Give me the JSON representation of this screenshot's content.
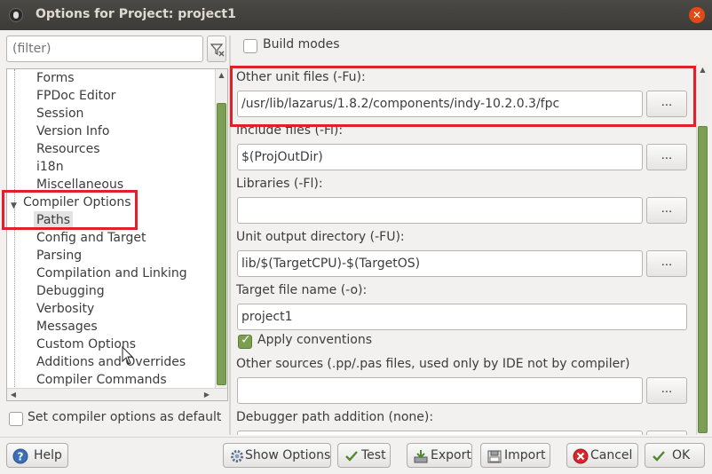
{
  "window": {
    "title": "Options for Project: project1",
    "close_glyph": "✕"
  },
  "filter": {
    "placeholder": "(filter)"
  },
  "tree": {
    "items": [
      {
        "label": "Forms"
      },
      {
        "label": "FPDoc Editor"
      },
      {
        "label": "Session"
      },
      {
        "label": "Version Info"
      },
      {
        "label": "Resources"
      },
      {
        "label": "i18n"
      },
      {
        "label": "Miscellaneous"
      },
      {
        "label": "Compiler Options"
      },
      {
        "label": "Paths",
        "selected": true
      },
      {
        "label": "Config and Target"
      },
      {
        "label": "Parsing"
      },
      {
        "label": "Compilation and Linking"
      },
      {
        "label": "Debugging"
      },
      {
        "label": "Verbosity"
      },
      {
        "label": "Messages"
      },
      {
        "label": "Custom Options"
      },
      {
        "label": "Additions and Overrides"
      },
      {
        "label": "Compiler Commands"
      }
    ]
  },
  "left_bottom": {
    "set_default_label": "Set compiler options as default",
    "set_default_checked": false
  },
  "build_modes": {
    "label": "Build modes",
    "checked": false
  },
  "fields": {
    "other_unit_files": {
      "label": "Other unit files (-Fu):",
      "value": "/usr/lib/lazarus/1.8.2/components/indy-10.2.0.3/fpc"
    },
    "include_files": {
      "label": "Include files (-Fi):",
      "value": "$(ProjOutDir)"
    },
    "libraries": {
      "label": "Libraries (-Fl):",
      "value": ""
    },
    "unit_output": {
      "label": "Unit output directory (-FU):",
      "value": "lib/$(TargetCPU)-$(TargetOS)"
    },
    "target_file": {
      "label": "Target file name (-o):",
      "value": "project1"
    },
    "apply_conventions": {
      "label": "Apply conventions",
      "checked": true
    },
    "other_sources": {
      "label": "Other sources (.pp/.pas files, used only by IDE not by compiler)",
      "value": ""
    },
    "debugger_path": {
      "label": "Debugger path addition (none):",
      "value": ""
    },
    "browse_label": "..."
  },
  "buttons": {
    "help": "Help",
    "show_options": "Show Options",
    "test": "Test",
    "export": "Export",
    "import": "Import",
    "cancel": "Cancel",
    "ok": "OK"
  },
  "colors": {
    "highlight": "#e0202a",
    "scroll_thumb": "#7d9f55",
    "titlebar": "#3c3b37"
  }
}
